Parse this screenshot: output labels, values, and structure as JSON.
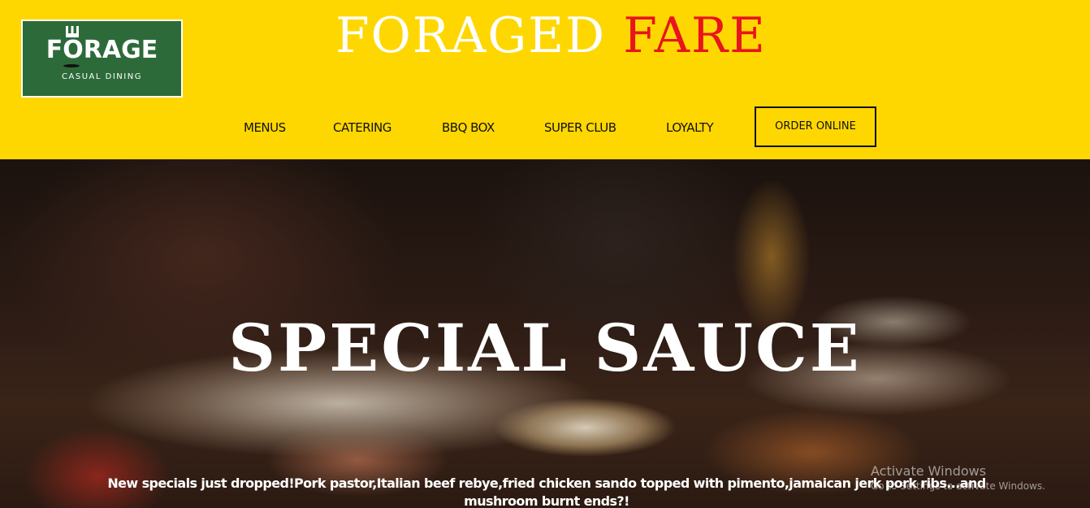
{
  "header": {
    "background_color": "#FFD700",
    "logo": {
      "word": "FORAGE",
      "subtitle": "CASUAL DINING",
      "color": "#2D6A3A",
      "icon": "fork-icon"
    },
    "title": {
      "part1": "FORAGED",
      "part2": "FARE",
      "part1_color": "#FFFFFF",
      "part2_color": "#E8141E"
    },
    "nav": {
      "items": [
        {
          "label": "MENUS"
        },
        {
          "label": "CATERING"
        },
        {
          "label": "BBQ BOX"
        },
        {
          "label": "SUPER CLUB"
        },
        {
          "label": "LOYALTY"
        }
      ],
      "cta_label": "ORDER ONLINE"
    }
  },
  "hero": {
    "title": "SPECIAL SAUCE",
    "description": "New specials just dropped!Pork pastor,Italian beef rebye,fried chicken sando topped with pimento,jamaican jerk pork ribs...and mushroom burnt ends?!"
  },
  "watermark": {
    "line1": "Activate Windows",
    "line2": "Go to Settings to activate Windows."
  }
}
